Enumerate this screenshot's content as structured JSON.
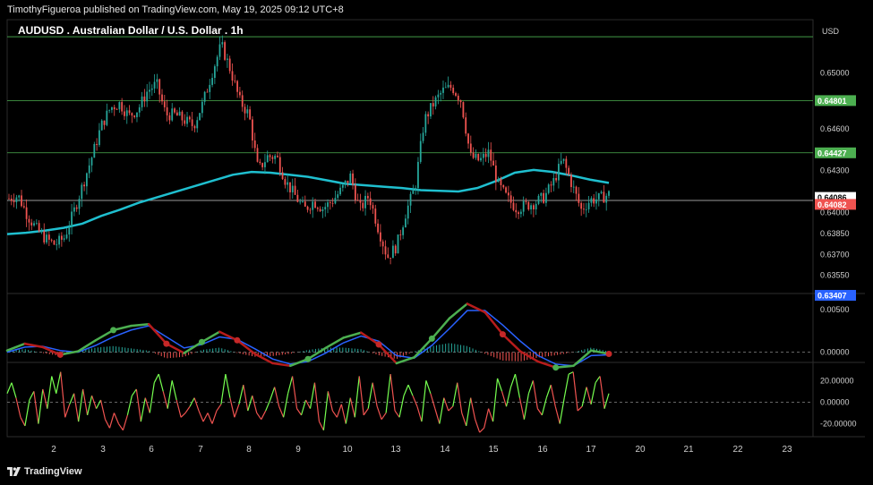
{
  "header": {
    "publisher_line": "TimothyFigueroa published on TradingView.com, May 19, 2025 09:12 UTC+8"
  },
  "footer": {
    "brand": "TradingView",
    "logo_icon": "tradingview-logo-icon"
  },
  "colors": {
    "up": "#26a69a",
    "down": "#ef5350",
    "ma": "#1fbfcf",
    "hline": "#4caf50",
    "macd_fast": "#2962ff",
    "macd_up": "#4caf50",
    "macd_down": "#b71c1c",
    "osc_up": "#76ff50",
    "osc_down": "#ef5350"
  },
  "chart_data": {
    "type": "candlestick",
    "title": "AUDUSD . Australian Dollar / U.S. Dollar . 1h",
    "currency": "USD",
    "x_ticks": [
      "2",
      "3",
      "6",
      "7",
      "8",
      "9",
      "10",
      "13",
      "14",
      "15",
      "16",
      "17",
      "20",
      "21",
      "22",
      "23"
    ],
    "price_ticks": [
      "0.65000",
      "0.64600",
      "0.64300",
      "0.64000",
      "0.63850",
      "0.63700",
      "0.63550"
    ],
    "ylim": [
      0.6342,
      0.6538
    ],
    "hlines": [
      {
        "price": 0.65258,
        "label": ""
      },
      {
        "price": 0.64801,
        "label": "0.64801"
      },
      {
        "price": 0.64427,
        "label": "0.64427"
      },
      {
        "price": 0.64086,
        "label": "0.64086"
      }
    ],
    "badges": [
      {
        "value": "0.64086",
        "price": 0.64108,
        "bg": "#ffffff",
        "fg": "#000000"
      },
      {
        "value": "0.64082",
        "price": 0.64058,
        "bg": "#ef5350",
        "fg": "#ffffff"
      },
      {
        "value": "0.63407",
        "price": 0.63407,
        "bg": "#2962ff",
        "fg": "#ffffff"
      }
    ],
    "close_series": [
      0.641,
      0.6412,
      0.6398,
      0.6388,
      0.6381,
      0.6377,
      0.6382,
      0.64,
      0.642,
      0.644,
      0.6462,
      0.6475,
      0.6478,
      0.6469,
      0.6474,
      0.6487,
      0.6492,
      0.647,
      0.647,
      0.6466,
      0.6462,
      0.6478,
      0.65,
      0.652,
      0.6502,
      0.648,
      0.647,
      0.643,
      0.644,
      0.644,
      0.6422,
      0.6412,
      0.6402,
      0.6408,
      0.6403,
      0.6408,
      0.6416,
      0.6426,
      0.6402,
      0.6412,
      0.6389,
      0.6368,
      0.6376,
      0.64,
      0.6418,
      0.6466,
      0.6478,
      0.6487,
      0.649,
      0.648,
      0.644,
      0.6437,
      0.6443,
      0.642,
      0.641,
      0.6403,
      0.6405,
      0.6407,
      0.6411,
      0.6422,
      0.6438,
      0.642,
      0.6402,
      0.6409,
      0.641,
      0.6413
    ],
    "ma_series": [
      0.63845,
      0.63855,
      0.6387,
      0.6389,
      0.6392,
      0.63975,
      0.6402,
      0.6407,
      0.6411,
      0.6415,
      0.6419,
      0.6423,
      0.6427,
      0.6429,
      0.64285,
      0.6427,
      0.64255,
      0.6423,
      0.64205,
      0.64195,
      0.64185,
      0.64175,
      0.6416,
      0.64155,
      0.6415,
      0.64175,
      0.64225,
      0.64285,
      0.64305,
      0.6429,
      0.64265,
      0.64235,
      0.64212
    ],
    "macd": {
      "ylim": [
        -0.0012,
        0.0068
      ],
      "ticks": [
        "0.00500",
        "0.00000"
      ],
      "zero": 0.0,
      "fast": [
        0.0002,
        0.001,
        0.0006,
        -0.0003,
        0.0001,
        0.0014,
        0.0026,
        0.0031,
        0.0033,
        0.001,
        -0.0001,
        0.0012,
        0.0024,
        0.0014,
        -0.0002,
        -0.0013,
        -0.0016,
        -0.0008,
        0.0005,
        0.0017,
        0.0023,
        0.0009,
        -0.0013,
        -0.0006,
        0.0016,
        0.004,
        0.0057,
        0.0047,
        0.0021,
        0.0001,
        -0.0011,
        -0.0018,
        -0.0016,
        0.0002,
        -0.0002
      ],
      "signal": [
        0.0,
        0.0006,
        0.0007,
        0.0002,
        0.0,
        0.0008,
        0.0018,
        0.0026,
        0.0031,
        0.0018,
        0.0005,
        0.0009,
        0.0018,
        0.0015,
        0.0004,
        -0.0008,
        -0.0014,
        -0.0011,
        -0.0001,
        0.0011,
        0.0019,
        0.0013,
        -0.0004,
        -0.0007,
        0.0008,
        0.0028,
        0.0049,
        0.0049,
        0.0032,
        0.0013,
        -0.0004,
        -0.0014,
        -0.0016,
        -0.0004,
        -0.0003
      ],
      "crosses_up": [
        6,
        11,
        17,
        24,
        31
      ],
      "crosses_down": [
        3,
        9,
        13,
        21,
        28,
        34
      ]
    },
    "oscillator": {
      "ylim": [
        -32,
        36
      ],
      "ticks": [
        "20.00000",
        "0.00000",
        "-20.00000"
      ],
      "dashed_levels": [
        0
      ],
      "values": [
        8,
        18,
        4,
        -14,
        -22,
        2,
        10,
        -20,
        12,
        -6,
        24,
        8,
        28,
        -14,
        -2,
        8,
        -18,
        12,
        -12,
        6,
        -6,
        2,
        -16,
        -24,
        -10,
        -20,
        -26,
        -12,
        6,
        12,
        -18,
        4,
        -10,
        18,
        26,
        10,
        -6,
        20,
        2,
        -14,
        -10,
        -4,
        4,
        -8,
        -18,
        -10,
        -20,
        -8,
        -2,
        26,
        4,
        -14,
        -2,
        16,
        -8,
        6,
        -10,
        -16,
        -8,
        2,
        14,
        -4,
        -14,
        8,
        24,
        -6,
        -12,
        2,
        -6,
        18,
        -18,
        -26,
        10,
        -8,
        -14,
        -2,
        -20,
        4,
        -14,
        24,
        -12,
        -6,
        18,
        -4,
        -16,
        -10,
        26,
        -8,
        -14,
        6,
        16,
        6,
        -4,
        -18,
        20,
        8,
        -6,
        -20,
        4,
        -8,
        -4,
        18,
        -10,
        -22,
        4,
        -16,
        -28,
        -24,
        -6,
        -18,
        22,
        10,
        -4,
        14,
        26,
        4,
        -16,
        8,
        20,
        -6,
        -12,
        4,
        16,
        -4,
        -20,
        4,
        26,
        28,
        -8,
        -4,
        14,
        -2,
        18,
        24,
        -6,
        8
      ]
    }
  }
}
